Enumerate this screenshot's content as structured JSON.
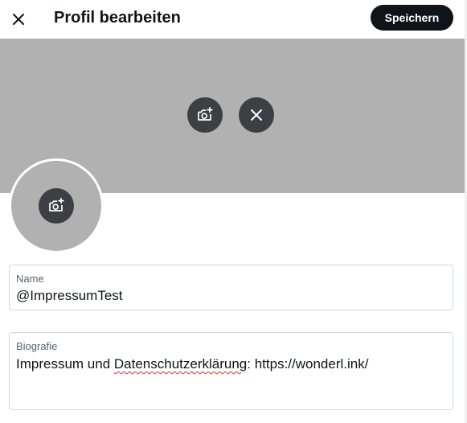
{
  "header": {
    "title": "Profil bearbeiten",
    "close_icon": "close-icon",
    "save_label": "Speichern"
  },
  "banner": {
    "color": "#b1b1b1",
    "add_photo_icon": "camera-plus-icon",
    "remove_icon": "close-icon"
  },
  "avatar": {
    "add_photo_icon": "camera-plus-icon"
  },
  "fields": {
    "name": {
      "label": "Name",
      "value": "@ImpressumTest"
    },
    "bio": {
      "label": "Biografie",
      "value_before": "Impressum und ",
      "value_misspelled": "Datenschutzerklärung",
      "value_after": ": https://wonderl.ink/"
    }
  },
  "colors": {
    "primary_button": "#0f1419",
    "field_border": "#cfd9de",
    "label_gray": "#536471"
  }
}
